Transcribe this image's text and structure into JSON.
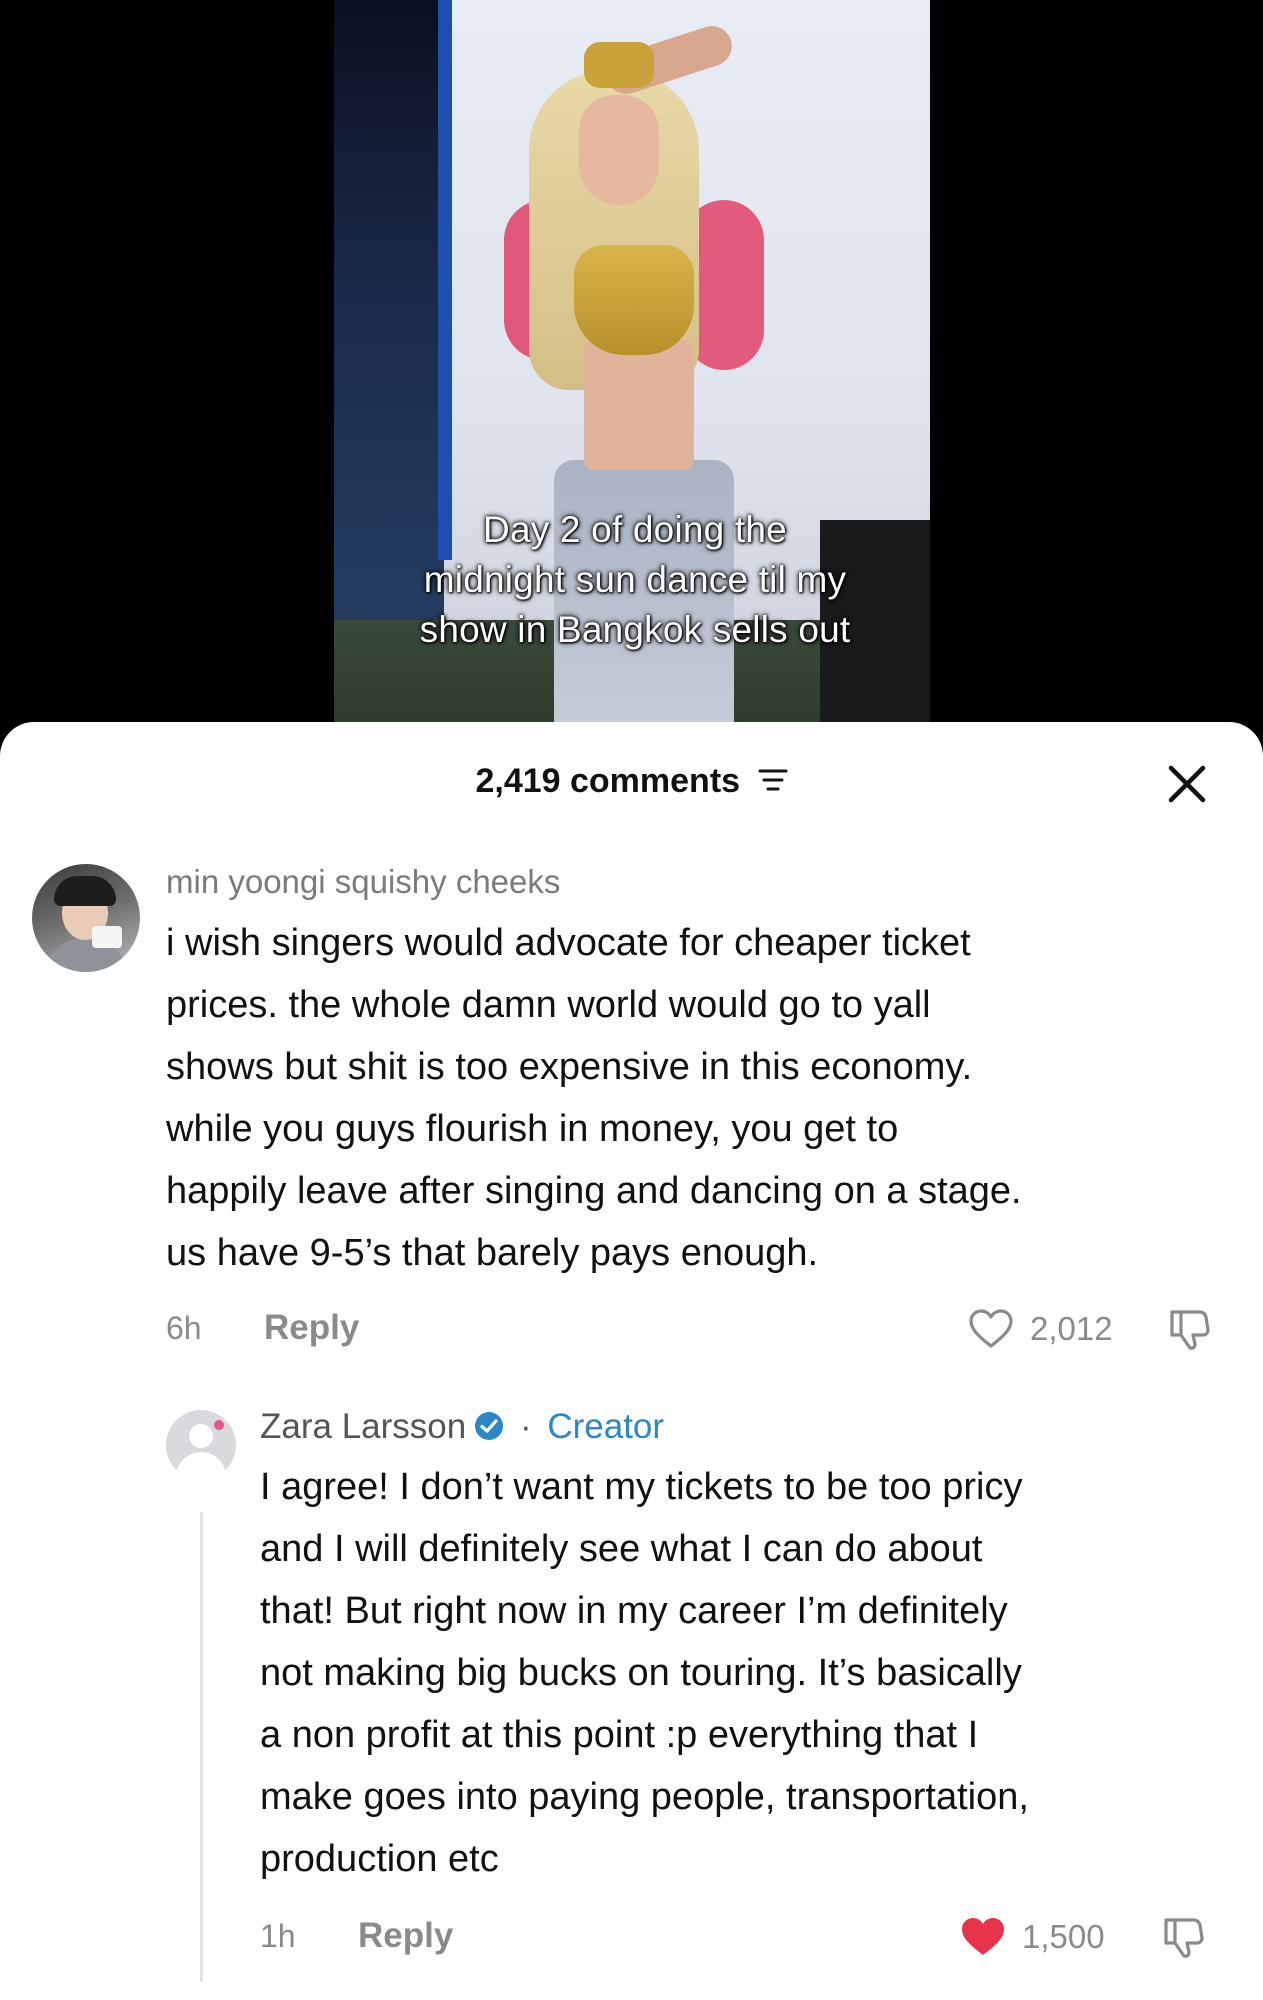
{
  "video": {
    "caption_lines": [
      "Day 2 of doing the",
      "midnight sun dance til my",
      "show in Bangkok sells out"
    ]
  },
  "comments_panel": {
    "count_label": "2,419 comments",
    "filter_icon": "filter-icon",
    "close_icon": "close-icon"
  },
  "comments": [
    {
      "username": "min yoongi squishy cheeks",
      "text_lines": [
        "i wish singers would advocate for cheaper ticket",
        "prices. the whole damn world would go to yall",
        "shows but shit is too expensive in this economy.",
        "while you guys flourish in money, you get to",
        "happily leave after singing and dancing on a stage.",
        "us have 9-5’s that barely pays enough."
      ],
      "time": "6h",
      "reply_label": "Reply",
      "likes": "2,012",
      "liked": false
    }
  ],
  "reply": {
    "username": "Zara Larsson",
    "separator": "·",
    "badge": "Creator",
    "text_lines": [
      "I agree! I don’t want my tickets to be too pricy",
      "and I will definitely see what I can do about",
      "that! But right now in my career I’m definitely",
      "not making big bucks on touring. It’s basically",
      "a non profit at this point :p everything that I",
      "make goes into paying people, transportation,",
      "production etc"
    ],
    "time": "1h",
    "reply_label": "Reply",
    "likes": "1,500",
    "liked": true
  },
  "colors": {
    "like_red": "#e8334a",
    "creator_blue": "#2c87c9",
    "muted_text": "#8a8a8a"
  }
}
